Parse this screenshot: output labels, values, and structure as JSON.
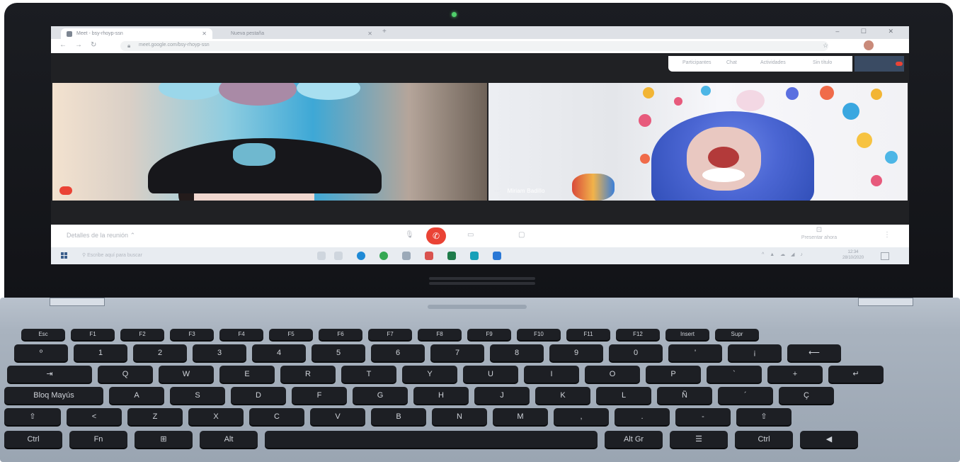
{
  "browser": {
    "active_tab": "Meet - bsy-rhoyp-ssn",
    "inactive_tab": "Nueva pestaña",
    "url": "meet.google.com/bsy-rhoyp-ssn",
    "window_controls": "– ☐ ✕"
  },
  "meet": {
    "top_panel": [
      "Participantes",
      "Chat",
      "Actividades",
      "Sin título"
    ],
    "participant_right_name": "Miriam Badillo",
    "meeting_details": "Detalles de la reunión",
    "present_now": "Presentar ahora",
    "leave_icon": "phone-hangup-icon"
  },
  "taskbar": {
    "search_placeholder": "Escribe aquí para buscar",
    "clock_time": "12:34",
    "clock_date": "28/10/2020"
  },
  "keyboard": {
    "row1": [
      "Esc",
      "F1",
      "F2",
      "F3",
      "F4",
      "F5",
      "F6",
      "F7",
      "F8",
      "F9",
      "F10",
      "F11",
      "F12",
      "Insert",
      "Supr"
    ],
    "row2": [
      "º",
      "1",
      "2",
      "3",
      "4",
      "5",
      "6",
      "7",
      "8",
      "9",
      "0",
      "'",
      "¡",
      "⟵"
    ],
    "row3": [
      "⇥",
      "Q",
      "W",
      "E",
      "R",
      "T",
      "Y",
      "U",
      "I",
      "O",
      "P",
      "`",
      "+",
      "↵"
    ],
    "row4": [
      "Bloq Mayús",
      "A",
      "S",
      "D",
      "F",
      "G",
      "H",
      "J",
      "K",
      "L",
      "Ñ",
      "´",
      "Ç"
    ],
    "row5": [
      "⇧",
      "<",
      "Z",
      "X",
      "C",
      "V",
      "B",
      "N",
      "M",
      ",",
      ".",
      "-",
      "⇧"
    ],
    "row6": [
      "Ctrl",
      "Fn",
      "⊞",
      "Alt",
      "",
      "Alt Gr",
      "☰",
      "Ctrl",
      "◀"
    ],
    "caps_caption": "Bloq Mayús"
  },
  "colors": {
    "leave_red": "#ea4335",
    "bezel": "#17181c",
    "deck": "#a9b3bf"
  }
}
